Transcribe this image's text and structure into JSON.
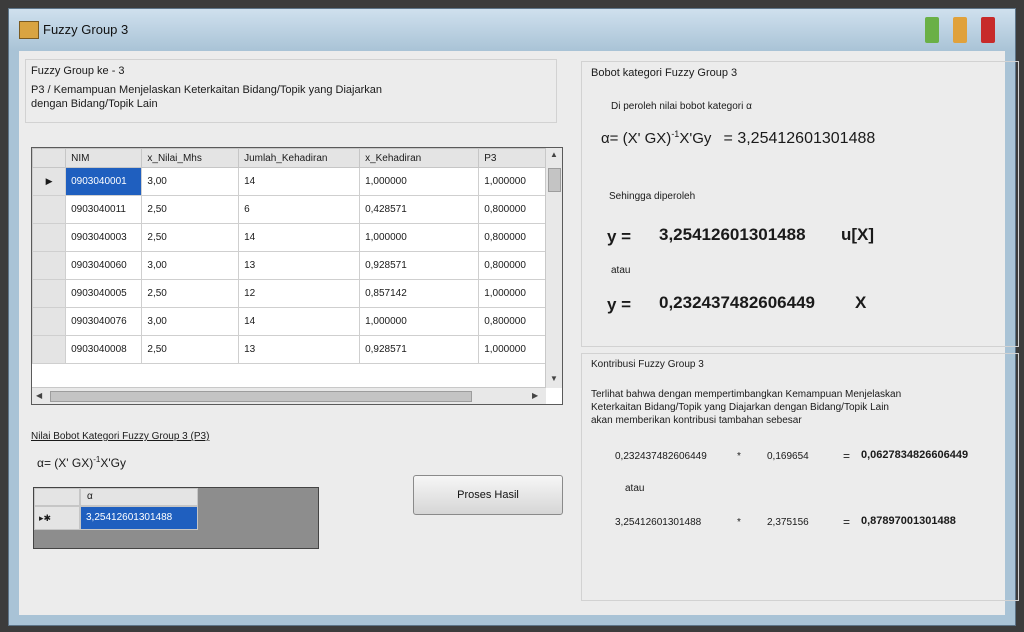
{
  "window": {
    "title": "Fuzzy Group 3"
  },
  "left": {
    "group_title": "Fuzzy Group ke - 3",
    "description_line1": "P3 / Kemampuan Menjelaskan Keterkaitan Bidang/Topik yang Diajarkan",
    "description_line2": "dengan Bidang/Topik Lain",
    "grid": {
      "columns": [
        "NIM",
        "x_Nilai_Mhs",
        "Jumlah_Kehadiran",
        "x_Kehadiran",
        "P3"
      ],
      "rows": [
        [
          "0903040001",
          "3,00",
          "14",
          "1,000000",
          "1,000000"
        ],
        [
          "0903040011",
          "2,50",
          "6",
          "0,428571",
          "0,800000"
        ],
        [
          "0903040003",
          "2,50",
          "14",
          "1,000000",
          "0,800000"
        ],
        [
          "0903040060",
          "3,00",
          "13",
          "0,928571",
          "0,800000"
        ],
        [
          "0903040005",
          "2,50",
          "12",
          "0,857142",
          "1,000000"
        ],
        [
          "0903040076",
          "3,00",
          "14",
          "1,000000",
          "0,800000"
        ],
        [
          "0903040008",
          "2,50",
          "13",
          "0,928571",
          "1,000000"
        ]
      ]
    },
    "weight_label": "Nilai Bobot Kategori Fuzzy Group 3 (P3)",
    "formula": "α= (X' GX)",
    "formula_sup": "-1",
    "formula_tail": "X'Gy",
    "result_grid": {
      "column": "α",
      "value": "3,25412601301488"
    },
    "process_button": "Proses Hasil"
  },
  "right": {
    "weight_group_title": "Bobot kategori Fuzzy Group 3",
    "obtained_text": "Di peroleh nilai bobot kategori α",
    "alpha_formula": "α= (X' GX)",
    "alpha_sup": "-1",
    "alpha_tail": "X'Gy",
    "alpha_value": "= 3,25412601301488",
    "so_text": "Sehingga diperoleh",
    "y_label": "y =",
    "y1_value": "3,25412601301488",
    "y1_tail": "u[X]",
    "or_text": "atau",
    "y2_value": "0,232437482606449",
    "y2_tail": "X",
    "contrib_title": "Kontribusi Fuzzy Group 3",
    "contrib_line1": "Terlihat bahwa dengan mempertimbangkan Kemampuan Menjelaskan",
    "contrib_line2": "Keterkaitan Bidang/Topik yang Diajarkan dengan Bidang/Topik Lain",
    "contrib_line3": "akan memberikan kontribusi tambahan sebesar",
    "calc1": {
      "a": "0,232437482606449",
      "op": "*",
      "b": "0,169654",
      "eq": "=",
      "result": "0,0627834826606449"
    },
    "calc_or": "atau",
    "calc2": {
      "a": "3,25412601301488",
      "op": "*",
      "b": "2,375156",
      "eq": "=",
      "result": "0,87897001301488"
    }
  },
  "colors": {
    "selection": "#1f5fbf",
    "window_frame": "#a9c3d6"
  }
}
